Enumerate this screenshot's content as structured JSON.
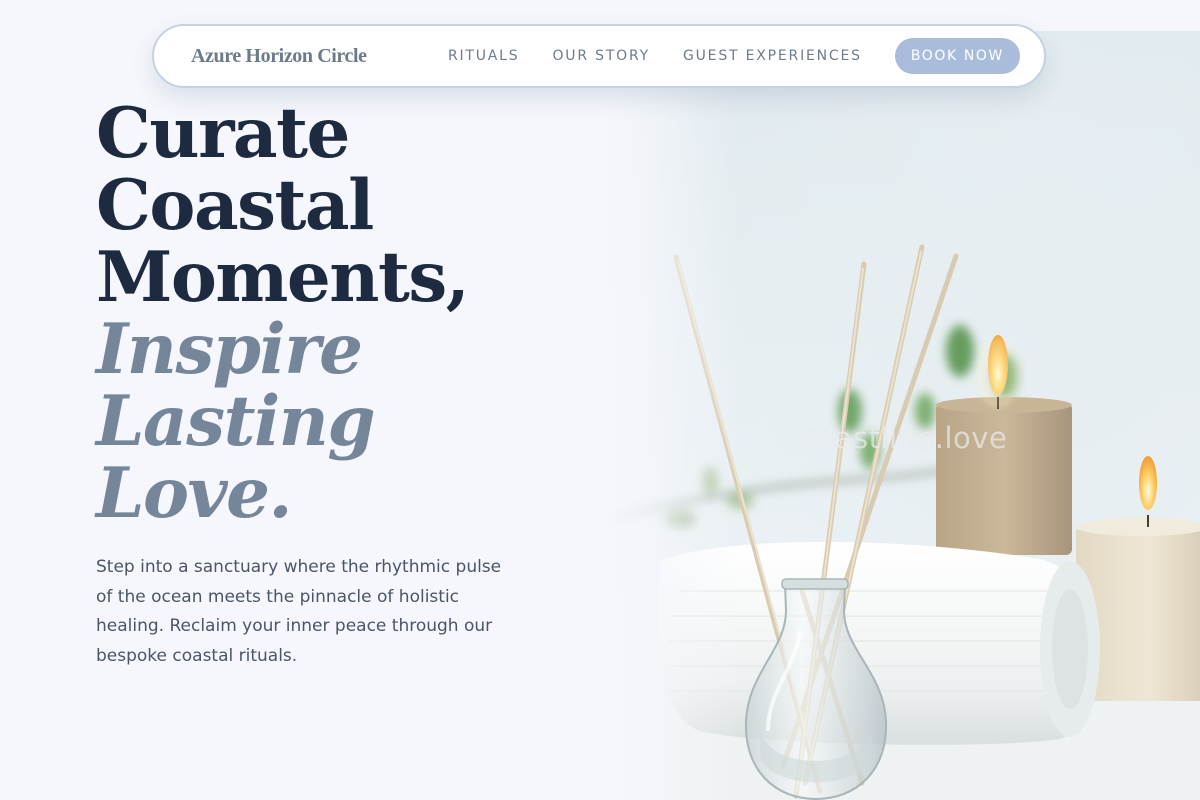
{
  "nav": {
    "brand": "Azure Horizon Circle",
    "links": [
      {
        "label": "RITUALS"
      },
      {
        "label": "OUR STORY"
      },
      {
        "label": "GUEST EXPERIENCES"
      }
    ],
    "cta_label": "BOOK NOW"
  },
  "hero": {
    "headline_lines": [
      "Curate",
      "Coastal",
      "Moments,"
    ],
    "headline_italic_lines": [
      "Inspire",
      "Lasting",
      "Love."
    ],
    "intro": "Step into a sanctuary where the rhythmic pulse of the ocean meets the pinnacle of holistic healing. Reclaim your inner peace through our bespoke coastal rituals.",
    "image_watermark": "coastline.love"
  },
  "colors": {
    "background": "#f5f7fc",
    "heading": "#1d2a3f",
    "heading_italic": "#76869a",
    "cta": "#a9bcdb",
    "nav_border": "#c5d2e2"
  }
}
